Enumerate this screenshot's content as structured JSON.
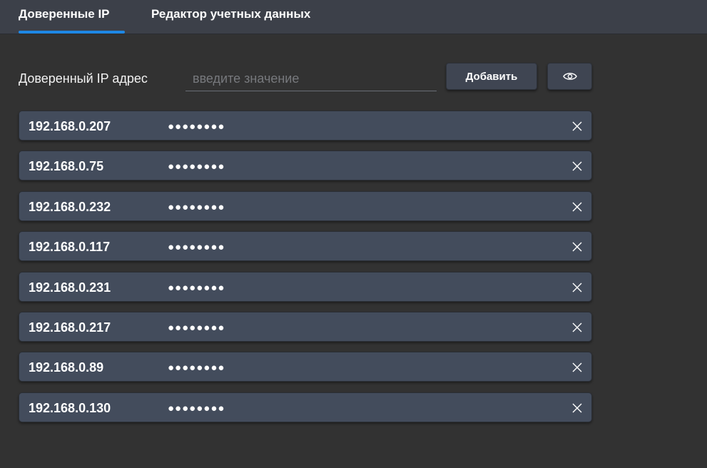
{
  "tabs": [
    {
      "label": "Доверенные IP",
      "active": true
    },
    {
      "label": "Редактор учетных данных",
      "active": false
    }
  ],
  "form": {
    "label": "Доверенный IP адрес",
    "input_value": "",
    "input_placeholder": "введите значение",
    "add_button_label": "Добавить",
    "visibility_icon": "eye-icon"
  },
  "entries": [
    {
      "ip": "192.168.0.207",
      "password": "●●●●●●●●"
    },
    {
      "ip": "192.168.0.75",
      "password": "●●●●●●●●"
    },
    {
      "ip": "192.168.0.232",
      "password": "●●●●●●●●"
    },
    {
      "ip": "192.168.0.117",
      "password": "●●●●●●●●"
    },
    {
      "ip": "192.168.0.231",
      "password": "●●●●●●●●"
    },
    {
      "ip": "192.168.0.217",
      "password": "●●●●●●●●"
    },
    {
      "ip": "192.168.0.89",
      "password": "●●●●●●●●"
    },
    {
      "ip": "192.168.0.130",
      "password": "●●●●●●●●"
    }
  ],
  "colors": {
    "background": "#323232",
    "tabbar": "#3c4049",
    "accent": "#1e88e5",
    "row": "#434c5c",
    "button": "#3f4552"
  }
}
